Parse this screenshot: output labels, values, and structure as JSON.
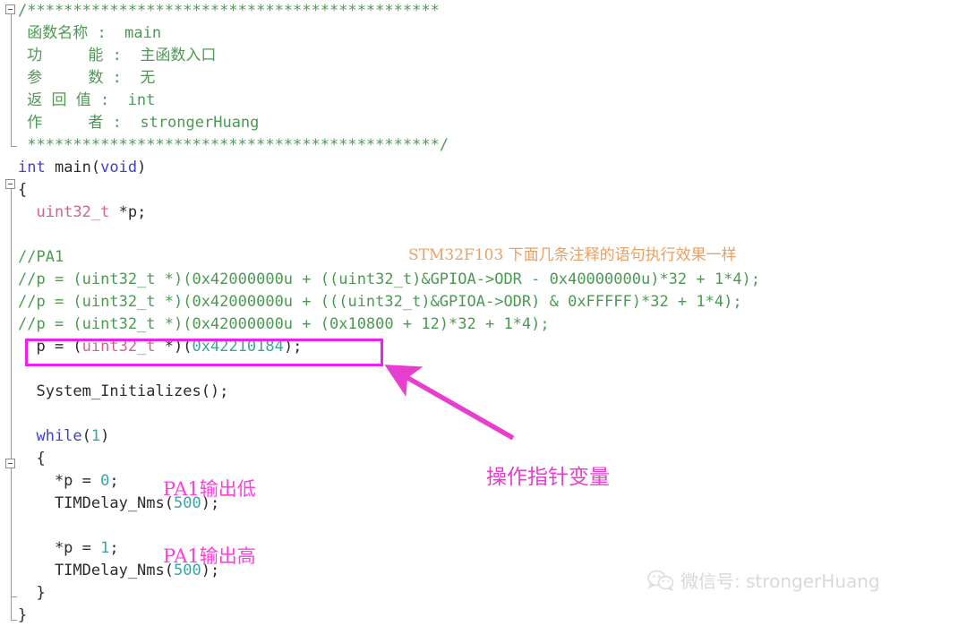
{
  "editor": {
    "title": "STM32 main.c code listing",
    "colors": {
      "comment": "#4c9a52",
      "keyword": "#4141c8",
      "plain": "#2b2b2b",
      "type": "#d4628c",
      "number": "#3ba3a3",
      "highlight_box": "#f01ef0",
      "arrow": "#e83ecf",
      "annotation_pink": "#ff3ee0",
      "annotation_orange": "#e8a063",
      "watermark": "#d9d9d9",
      "background": "#ffffff"
    }
  },
  "code_lines": [
    {
      "indent": 0,
      "segments": [
        {
          "cls": "cmt",
          "text": "/*********************************************"
        }
      ]
    },
    {
      "indent": 0,
      "segments": [
        {
          "cls": "cmt",
          "text": " 函数名称 :  main"
        }
      ]
    },
    {
      "indent": 0,
      "segments": [
        {
          "cls": "cmt",
          "text": " 功     能 :  主函数入口"
        }
      ]
    },
    {
      "indent": 0,
      "segments": [
        {
          "cls": "cmt",
          "text": " 参     数 :  无"
        }
      ]
    },
    {
      "indent": 0,
      "segments": [
        {
          "cls": "cmt",
          "text": " 返 回 值 :  int"
        }
      ]
    },
    {
      "indent": 0,
      "segments": [
        {
          "cls": "cmt",
          "text": " 作     者 :  strongerHuang"
        }
      ]
    },
    {
      "indent": 0,
      "segments": [
        {
          "cls": "cmt",
          "text": " *********************************************/"
        }
      ]
    },
    {
      "indent": 0,
      "segments": [
        {
          "cls": "kw",
          "text": "int"
        },
        {
          "cls": "plain",
          "text": " main("
        },
        {
          "cls": "kw",
          "text": "void"
        },
        {
          "cls": "plain",
          "text": ")"
        }
      ]
    },
    {
      "indent": 0,
      "segments": [
        {
          "cls": "plain",
          "text": "{"
        }
      ]
    },
    {
      "indent": 0,
      "segments": [
        {
          "cls": "type",
          "text": "  uint32_t"
        },
        {
          "cls": "plain",
          "text": " *p;"
        }
      ]
    },
    {
      "indent": 0,
      "segments": [
        {
          "cls": "plain",
          "text": ""
        }
      ]
    },
    {
      "indent": 0,
      "segments": [
        {
          "cls": "cmt",
          "text": "//PA1"
        }
      ]
    },
    {
      "indent": 0,
      "segments": [
        {
          "cls": "cmt",
          "text": "//p = (uint32_t *)(0x42000000u + ((uint32_t)&GPIOA->ODR - 0x40000000u)*32 + 1*4);"
        }
      ]
    },
    {
      "indent": 0,
      "segments": [
        {
          "cls": "cmt",
          "text": "//p = (uint32_t *)(0x42000000u + (((uint32_t)&GPIOA->ODR) & 0xFFFFF)*32 + 1*4);"
        }
      ]
    },
    {
      "indent": 0,
      "segments": [
        {
          "cls": "cmt",
          "text": "//p = (uint32_t *)(0x42000000u + (0x10800 + 12)*32 + 1*4);"
        }
      ]
    },
    {
      "indent": 0,
      "segments": [
        {
          "cls": "plain",
          "text": "  p = ("
        },
        {
          "cls": "type",
          "text": "uint32_t"
        },
        {
          "cls": "plain",
          "text": " *)("
        },
        {
          "cls": "num",
          "text": "0x42210184"
        },
        {
          "cls": "plain",
          "text": ");"
        }
      ]
    },
    {
      "indent": 0,
      "segments": [
        {
          "cls": "plain",
          "text": ""
        }
      ]
    },
    {
      "indent": 0,
      "segments": [
        {
          "cls": "plain",
          "text": "  System_Initializes();"
        }
      ]
    },
    {
      "indent": 0,
      "segments": [
        {
          "cls": "plain",
          "text": ""
        }
      ]
    },
    {
      "indent": 0,
      "segments": [
        {
          "cls": "kw",
          "text": "  while"
        },
        {
          "cls": "plain",
          "text": "("
        },
        {
          "cls": "num",
          "text": "1"
        },
        {
          "cls": "plain",
          "text": ")"
        }
      ]
    },
    {
      "indent": 0,
      "segments": [
        {
          "cls": "plain",
          "text": "  {"
        }
      ]
    },
    {
      "indent": 0,
      "segments": [
        {
          "cls": "plain",
          "text": "    *p = "
        },
        {
          "cls": "num",
          "text": "0"
        },
        {
          "cls": "plain",
          "text": ";"
        }
      ]
    },
    {
      "indent": 0,
      "segments": [
        {
          "cls": "plain",
          "text": "    TIMDelay_Nms("
        },
        {
          "cls": "num",
          "text": "500"
        },
        {
          "cls": "plain",
          "text": ");"
        }
      ]
    },
    {
      "indent": 0,
      "segments": [
        {
          "cls": "plain",
          "text": ""
        }
      ]
    },
    {
      "indent": 0,
      "segments": [
        {
          "cls": "plain",
          "text": "    *p = "
        },
        {
          "cls": "num",
          "text": "1"
        },
        {
          "cls": "plain",
          "text": ";"
        }
      ]
    },
    {
      "indent": 0,
      "segments": [
        {
          "cls": "plain",
          "text": "    TIMDelay_Nms("
        },
        {
          "cls": "num",
          "text": "500"
        },
        {
          "cls": "plain",
          "text": ");"
        }
      ]
    },
    {
      "indent": 0,
      "segments": [
        {
          "cls": "plain",
          "text": "  }"
        }
      ]
    },
    {
      "indent": 0,
      "segments": [
        {
          "cls": "plain",
          "text": "}"
        }
      ]
    }
  ],
  "annotations": {
    "orange_note": "STM32F103 下面几条注释的语句执行效果一样",
    "pointer_label": "操作指针变量",
    "pa1_low": "PA1输出低",
    "pa1_high": "PA1输出高"
  },
  "highlight": {
    "line_text": "p = (uint32_t *)(0x42210184);"
  },
  "watermark": {
    "icon": "wechat-icon",
    "text": "微信号: strongerHuang"
  }
}
